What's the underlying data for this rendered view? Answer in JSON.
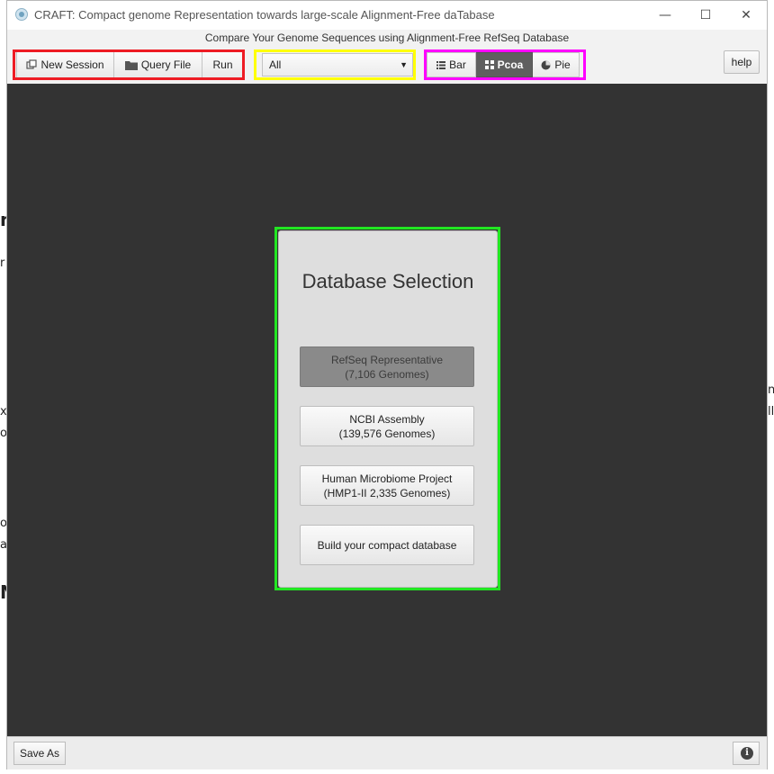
{
  "window": {
    "title": "CRAFT: Compact genome Representation towards large-scale Alignment-Free daTabase",
    "subtitle": "Compare Your Genome Sequences using Alignment-Free RefSeq Database",
    "controls": {
      "minimize": "—",
      "maximize": "☐",
      "close": "✕"
    }
  },
  "toolbar": {
    "new_session": "New Session",
    "query_file": "Query File",
    "run": "Run",
    "filter_value": "All",
    "views": [
      "Bar",
      "Pcoa",
      "Pie"
    ],
    "active_view": "Pcoa",
    "help": "help"
  },
  "panel": {
    "title": "Database Selection",
    "options": [
      {
        "line1": "RefSeq Representative",
        "line2": "(7,106 Genomes)",
        "active": true
      },
      {
        "line1": "NCBI Assembly",
        "line2": "(139,576 Genomes)",
        "active": false
      },
      {
        "line1": "Human Microbiome Project",
        "line2": "(HMP1-II 2,335 Genomes)",
        "active": false
      },
      {
        "line1": "Build your compact database",
        "line2": "",
        "active": false
      }
    ]
  },
  "statusbar": {
    "save_as": "Save As",
    "info_icon": "i"
  },
  "highlight_colors": {
    "red": "#ee1c24",
    "yellow": "#ffff00",
    "magenta": "#ff00ff",
    "green": "#22e622"
  }
}
